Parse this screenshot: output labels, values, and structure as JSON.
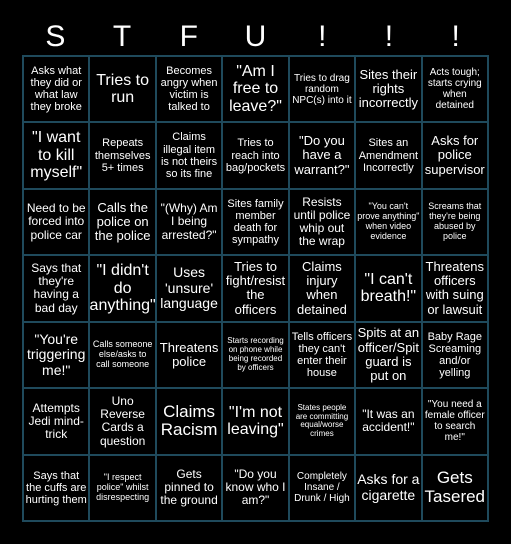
{
  "header": [
    "S",
    "T",
    "F",
    "U",
    "!",
    "!",
    "!"
  ],
  "colors": {
    "background": "#000000",
    "grid_line": "#1f4a5c",
    "text": "#ffffff"
  },
  "cells": [
    [
      "Asks what they did or what law they broke",
      "Tries to run",
      "Becomes angry when victim is talked to",
      "\"Am I free to leave?\"",
      "Tries to drag random NPC(s) into it",
      "Sites their rights incorrectly",
      "Acts tough; starts crying when detained"
    ],
    [
      "\"I want to kill myself\"",
      "Repeats themselves 5+ times",
      "Claims illegal item is not theirs so its fine",
      "Tries to reach into bag/pockets",
      "\"Do you have a warrant?\"",
      "Sites an Amendment Incorrectly",
      "Asks for police supervisor"
    ],
    [
      "Need to be forced into police car",
      "Calls the police on the police",
      "\"(Why) Am I being arrested?\"",
      "Sites family member death for sympathy",
      "Resists until police whip out the wrap",
      "\"You can't prove anything\" when video evidence",
      "Screams that they're being abused by police"
    ],
    [
      "Says that they're having a bad day",
      "\"I didn't do anything\"",
      "Uses 'unsure' language",
      "Tries to fight/resist the officers",
      "Claims injury when detained",
      "\"I can't breath!\"",
      "Threatens officers with suing or lawsuit"
    ],
    [
      "\"You're triggering me!\"",
      "Calls someone else/asks to call someone",
      "Threatens police",
      "Starts recording on phone while being recorded by officers",
      "Tells officers they can't enter their house",
      "Spits at an officer/Spit guard is put on",
      "Baby Rage Screaming and/or yelling"
    ],
    [
      "Attempts Jedi mind-trick",
      "Uno Reverse Cards a question",
      "Claims Racism",
      "\"I'm not leaving\"",
      "States people are committing equal/worse crimes",
      "\"It was an accident!\"",
      "\"You need a female officer to search me!\""
    ],
    [
      "Says that the cuffs are hurting them",
      "\"I respect police\" whilst disrespecting",
      "Gets pinned to the ground",
      "\"Do you know who I am?\"",
      "Completely Insane / Drunk / High",
      "Asks for a cigarette",
      "Gets Tasered"
    ]
  ]
}
